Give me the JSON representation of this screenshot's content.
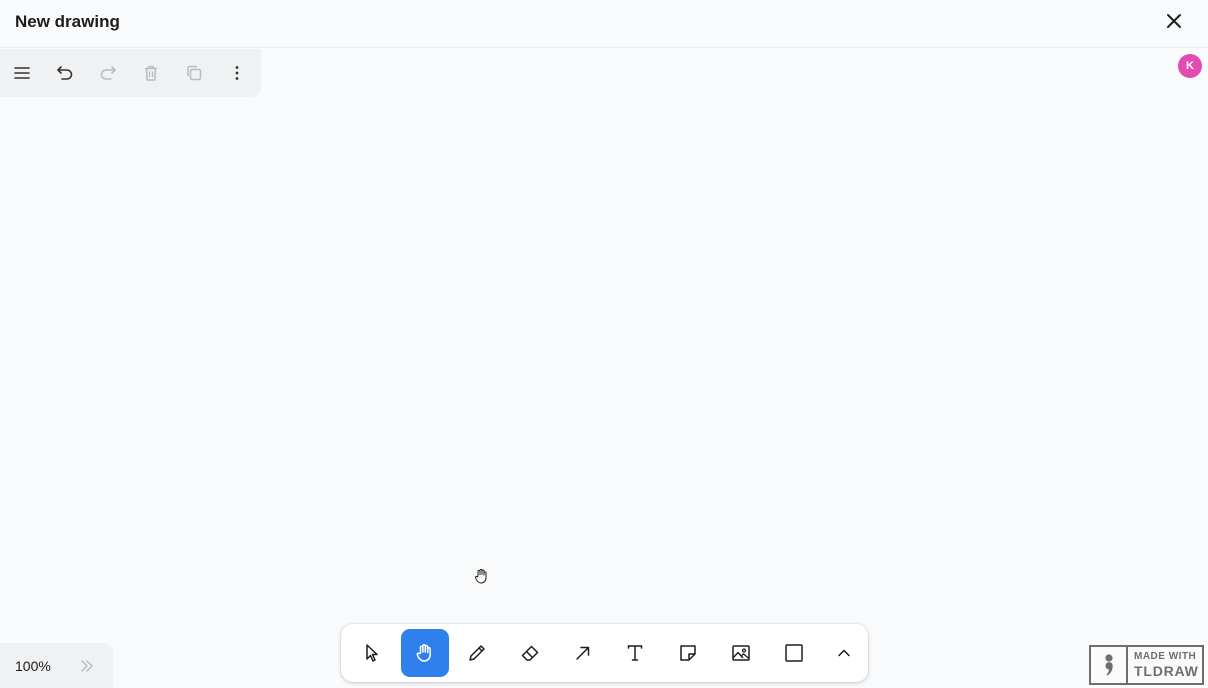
{
  "header": {
    "title": "New drawing",
    "close_icon": "close-icon"
  },
  "menu_panel": {
    "items": [
      {
        "name": "main-menu",
        "icon": "hamburger-icon",
        "enabled": true
      },
      {
        "name": "undo",
        "icon": "undo-icon",
        "enabled": true
      },
      {
        "name": "redo",
        "icon": "redo-icon",
        "enabled": false
      },
      {
        "name": "delete",
        "icon": "trash-icon",
        "enabled": false
      },
      {
        "name": "duplicate",
        "icon": "duplicate-icon",
        "enabled": false
      },
      {
        "name": "more",
        "icon": "kebab-icon",
        "enabled": true
      }
    ]
  },
  "user": {
    "avatar_initial": "K",
    "avatar_color": "#e24bb2"
  },
  "zoom": {
    "level": "100%",
    "minimap_icon": "double-chevron-right-icon"
  },
  "toolbar": {
    "active_tool": "hand",
    "active_color": "#2f80ed",
    "tools": [
      {
        "name": "select",
        "icon": "pointer-icon"
      },
      {
        "name": "hand",
        "icon": "hand-icon"
      },
      {
        "name": "draw",
        "icon": "pencil-icon"
      },
      {
        "name": "eraser",
        "icon": "eraser-icon"
      },
      {
        "name": "arrow",
        "icon": "arrow-icon"
      },
      {
        "name": "text",
        "icon": "text-icon"
      },
      {
        "name": "note",
        "icon": "sticky-note-icon"
      },
      {
        "name": "asset",
        "icon": "image-icon"
      },
      {
        "name": "rectangle",
        "icon": "rectangle-icon"
      },
      {
        "name": "more-tools",
        "icon": "chevron-up-icon"
      }
    ]
  },
  "watermark": {
    "line1": "MADE WITH",
    "line2": "TLDRAW"
  }
}
